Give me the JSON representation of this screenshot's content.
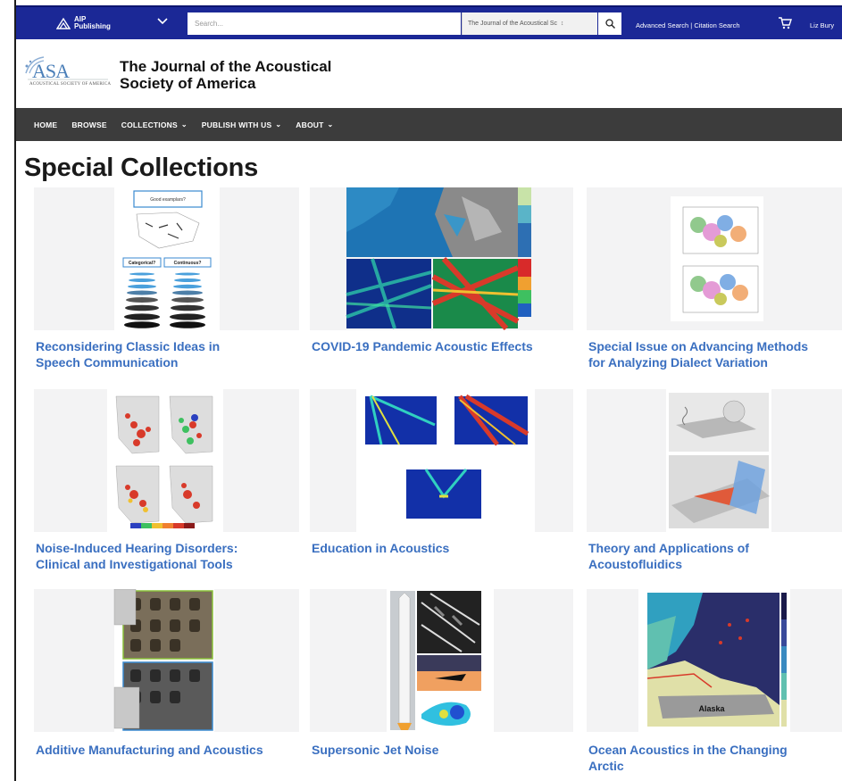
{
  "topbar": {
    "publisher_line1": "AIP",
    "publisher_line2": "Publishing",
    "search_placeholder": "Search...",
    "search_scope": "The Journal of the Acoustical Sc",
    "advanced_search": "Advanced Search | Citation Search",
    "user_name": "Liz Bury"
  },
  "journal": {
    "logo_text": "ASA",
    "logo_subtext": "ACOUSTICAL SOCIETY OF AMERICA",
    "title_line1": "The Journal of the Acoustical",
    "title_line2": "Society of America"
  },
  "nav": {
    "home": "HOME",
    "browse": "BROWSE",
    "collections": "COLLECTIONS",
    "publish": "PUBLISH WITH US",
    "about": "ABOUT"
  },
  "page_title": "Special Collections",
  "cards": [
    {
      "line1": "Reconsidering Classic Ideas in",
      "line2": "Speech Communication"
    },
    {
      "line1": "COVID-19 Pandemic Acoustic Effects",
      "line2": ""
    },
    {
      "line1": "Special Issue on Advancing Methods",
      "line2": "for Analyzing Dialect Variation"
    },
    {
      "line1": "Noise-Induced Hearing Disorders:",
      "line2": "Clinical and Investigational Tools"
    },
    {
      "line1": "Education in Acoustics",
      "line2": ""
    },
    {
      "line1": "Theory and Applications of",
      "line2": "Acoustofluidics"
    },
    {
      "line1": "Additive Manufacturing and Acoustics",
      "line2": ""
    },
    {
      "line1": "Supersonic Jet Noise",
      "line2": ""
    },
    {
      "line1": "Ocean Acoustics in the Changing",
      "line2": "Arctic"
    }
  ],
  "thumbs": {
    "speech_box1": "Good examplars?",
    "speech_box2": "Categorical?",
    "speech_box3": "Continuous?",
    "arctic_label": "Alaska"
  },
  "colors": {
    "topbar": "#1b2896",
    "nav": "#3c3c3c",
    "link": "#3a6fc0"
  },
  "icons": {
    "publisher": "aip-logo-icon",
    "dropdown": "chevron-down-icon",
    "search": "search-icon",
    "cart": "cart-icon"
  }
}
